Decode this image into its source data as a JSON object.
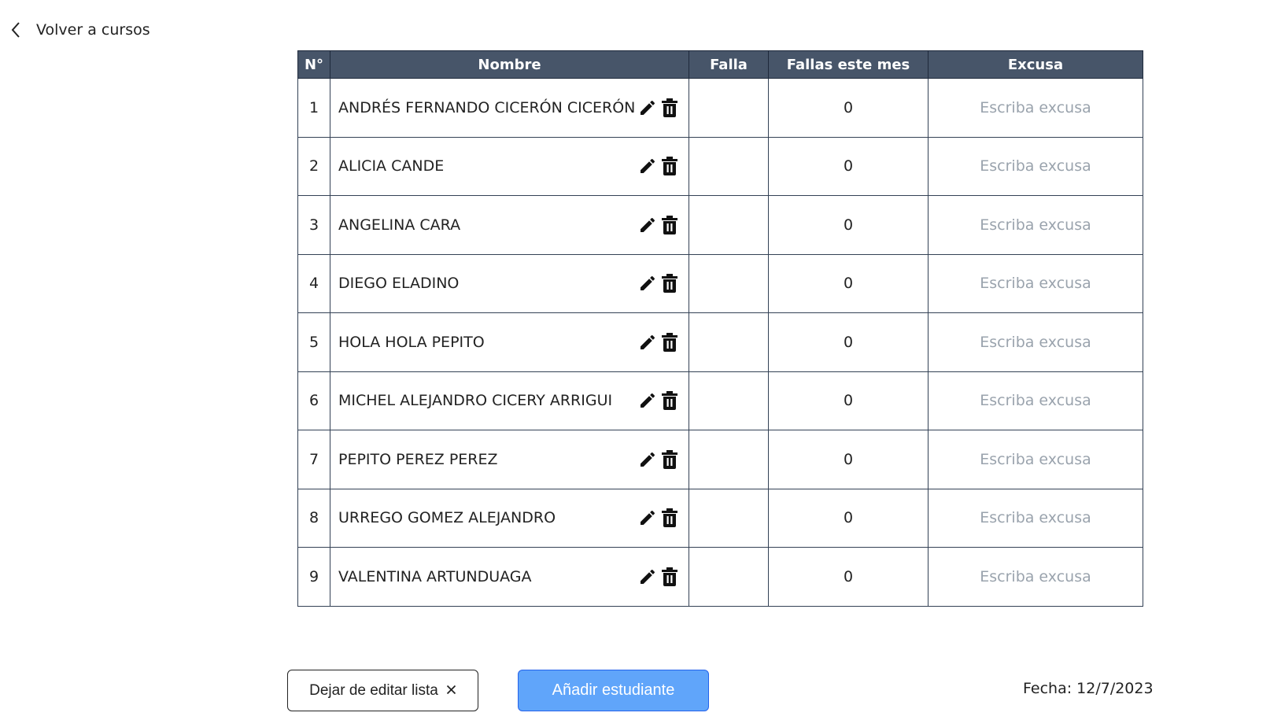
{
  "back_link": {
    "label": "Volver a cursos",
    "icon": "chevron-left-icon"
  },
  "table": {
    "columns": [
      "N°",
      "Nombre",
      "Falla",
      "Fallas este mes",
      "Excusa"
    ],
    "excuse_placeholder": "Escriba excusa",
    "row_icons": [
      "pencil-icon",
      "trash-icon"
    ],
    "rows": [
      {
        "num": "1",
        "name": "ANDRÉS FERNANDO CICERÓN CICERÓN",
        "falla": "",
        "fallas_mes": "0"
      },
      {
        "num": "2",
        "name": "ALICIA CANDE",
        "falla": "",
        "fallas_mes": "0"
      },
      {
        "num": "3",
        "name": "ANGELINA CARA",
        "falla": "",
        "fallas_mes": "0"
      },
      {
        "num": "4",
        "name": "DIEGO ELADINO",
        "falla": "",
        "fallas_mes": "0"
      },
      {
        "num": "5",
        "name": "HOLA HOLA PEPITO",
        "falla": "",
        "fallas_mes": "0"
      },
      {
        "num": "6",
        "name": "MICHEL ALEJANDRO CICERY ARRIGUI",
        "falla": "",
        "fallas_mes": "0"
      },
      {
        "num": "7",
        "name": "PEPITO PEREZ PEREZ",
        "falla": "",
        "fallas_mes": "0"
      },
      {
        "num": "8",
        "name": "URREGO GOMEZ ALEJANDRO",
        "falla": "",
        "fallas_mes": "0"
      },
      {
        "num": "9",
        "name": "VALENTINA ARTUNDUAGA",
        "falla": "",
        "fallas_mes": "0"
      }
    ]
  },
  "buttons": {
    "stop_editing": {
      "label": "Dejar de editar lista",
      "icon": "close-icon"
    },
    "add_student": {
      "label": "Añadir estudiante"
    }
  },
  "date": {
    "text": "Fecha: 12/7/2023"
  },
  "colors": {
    "header_bg": "#475569",
    "primary_button": "#60a5fa",
    "placeholder": "#9aa3ad"
  }
}
